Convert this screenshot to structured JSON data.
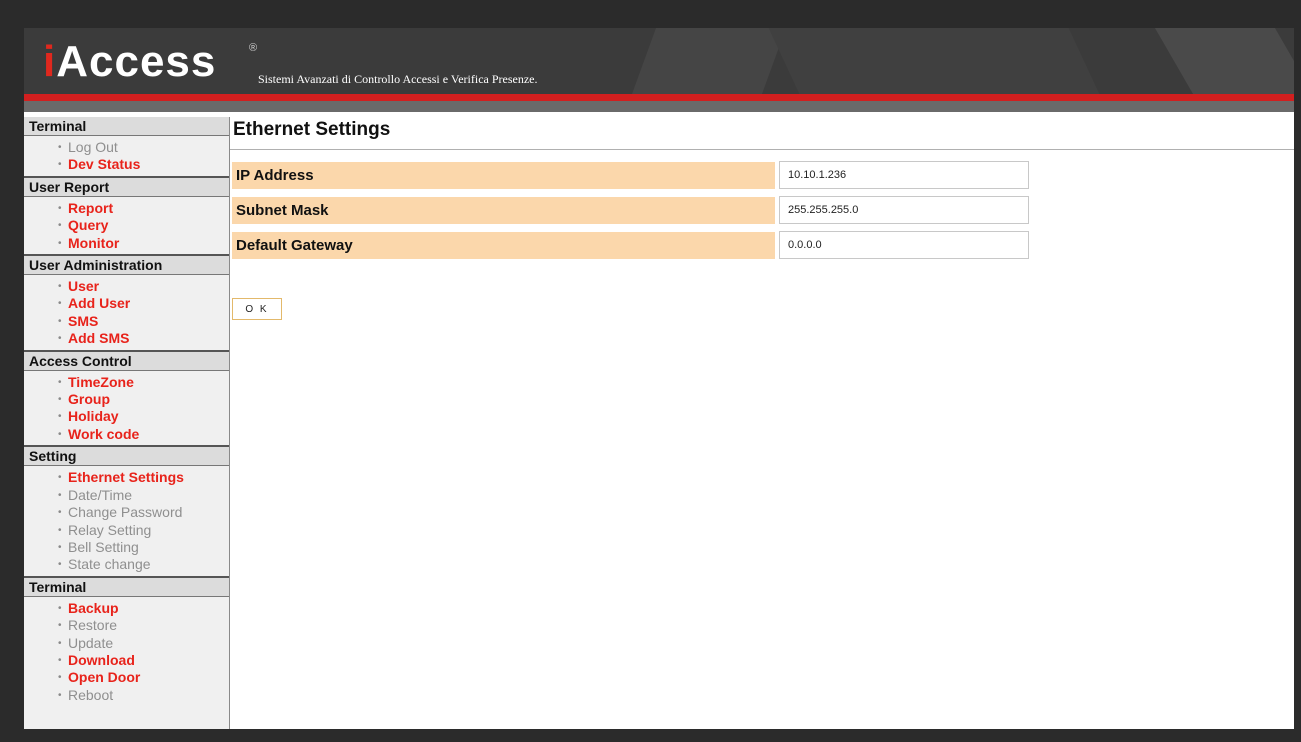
{
  "header": {
    "logo_i": "i",
    "logo_rest": "Access",
    "registered": "®",
    "tagline": "Sistemi Avanzati di Controllo Accessi e Verifica Presenze."
  },
  "sidebar": {
    "sections": [
      {
        "title": "Terminal",
        "items": [
          {
            "label": "Log Out",
            "active": false
          },
          {
            "label": "Dev Status",
            "active": true
          }
        ]
      },
      {
        "title": "User Report",
        "items": [
          {
            "label": "Report",
            "active": true
          },
          {
            "label": "Query",
            "active": true
          },
          {
            "label": "Monitor",
            "active": true
          }
        ]
      },
      {
        "title": "User Administration",
        "items": [
          {
            "label": "User",
            "active": true
          },
          {
            "label": "Add User",
            "active": true
          },
          {
            "label": "SMS",
            "active": true
          },
          {
            "label": "Add SMS",
            "active": true
          }
        ]
      },
      {
        "title": "Access Control",
        "items": [
          {
            "label": "TimeZone",
            "active": true
          },
          {
            "label": "Group",
            "active": true
          },
          {
            "label": "Holiday",
            "active": true
          },
          {
            "label": "Work code",
            "active": true
          }
        ]
      },
      {
        "title": "Setting",
        "items": [
          {
            "label": "Ethernet Settings",
            "active": true
          },
          {
            "label": "Date/Time",
            "active": false
          },
          {
            "label": "Change Password",
            "active": false
          },
          {
            "label": "Relay Setting",
            "active": false
          },
          {
            "label": "Bell Setting",
            "active": false
          },
          {
            "label": "State change",
            "active": false
          }
        ]
      },
      {
        "title": "Terminal",
        "items": [
          {
            "label": "Backup",
            "active": true
          },
          {
            "label": "Restore",
            "active": false
          },
          {
            "label": "Update",
            "active": false
          },
          {
            "label": "Download",
            "active": true
          },
          {
            "label": "Open Door",
            "active": true
          },
          {
            "label": "Reboot",
            "active": false
          }
        ]
      }
    ]
  },
  "main": {
    "title": "Ethernet Settings",
    "fields": [
      {
        "label": "IP Address",
        "value": "10.10.1.236"
      },
      {
        "label": "Subnet Mask",
        "value": "255.255.255.0"
      },
      {
        "label": "Default Gateway",
        "value": "0.0.0.0"
      }
    ],
    "ok_label": "O K"
  },
  "colors": {
    "accent_red": "#e8231b",
    "label_bg": "#fbd7ab",
    "header_bg": "#3b3b3b"
  }
}
